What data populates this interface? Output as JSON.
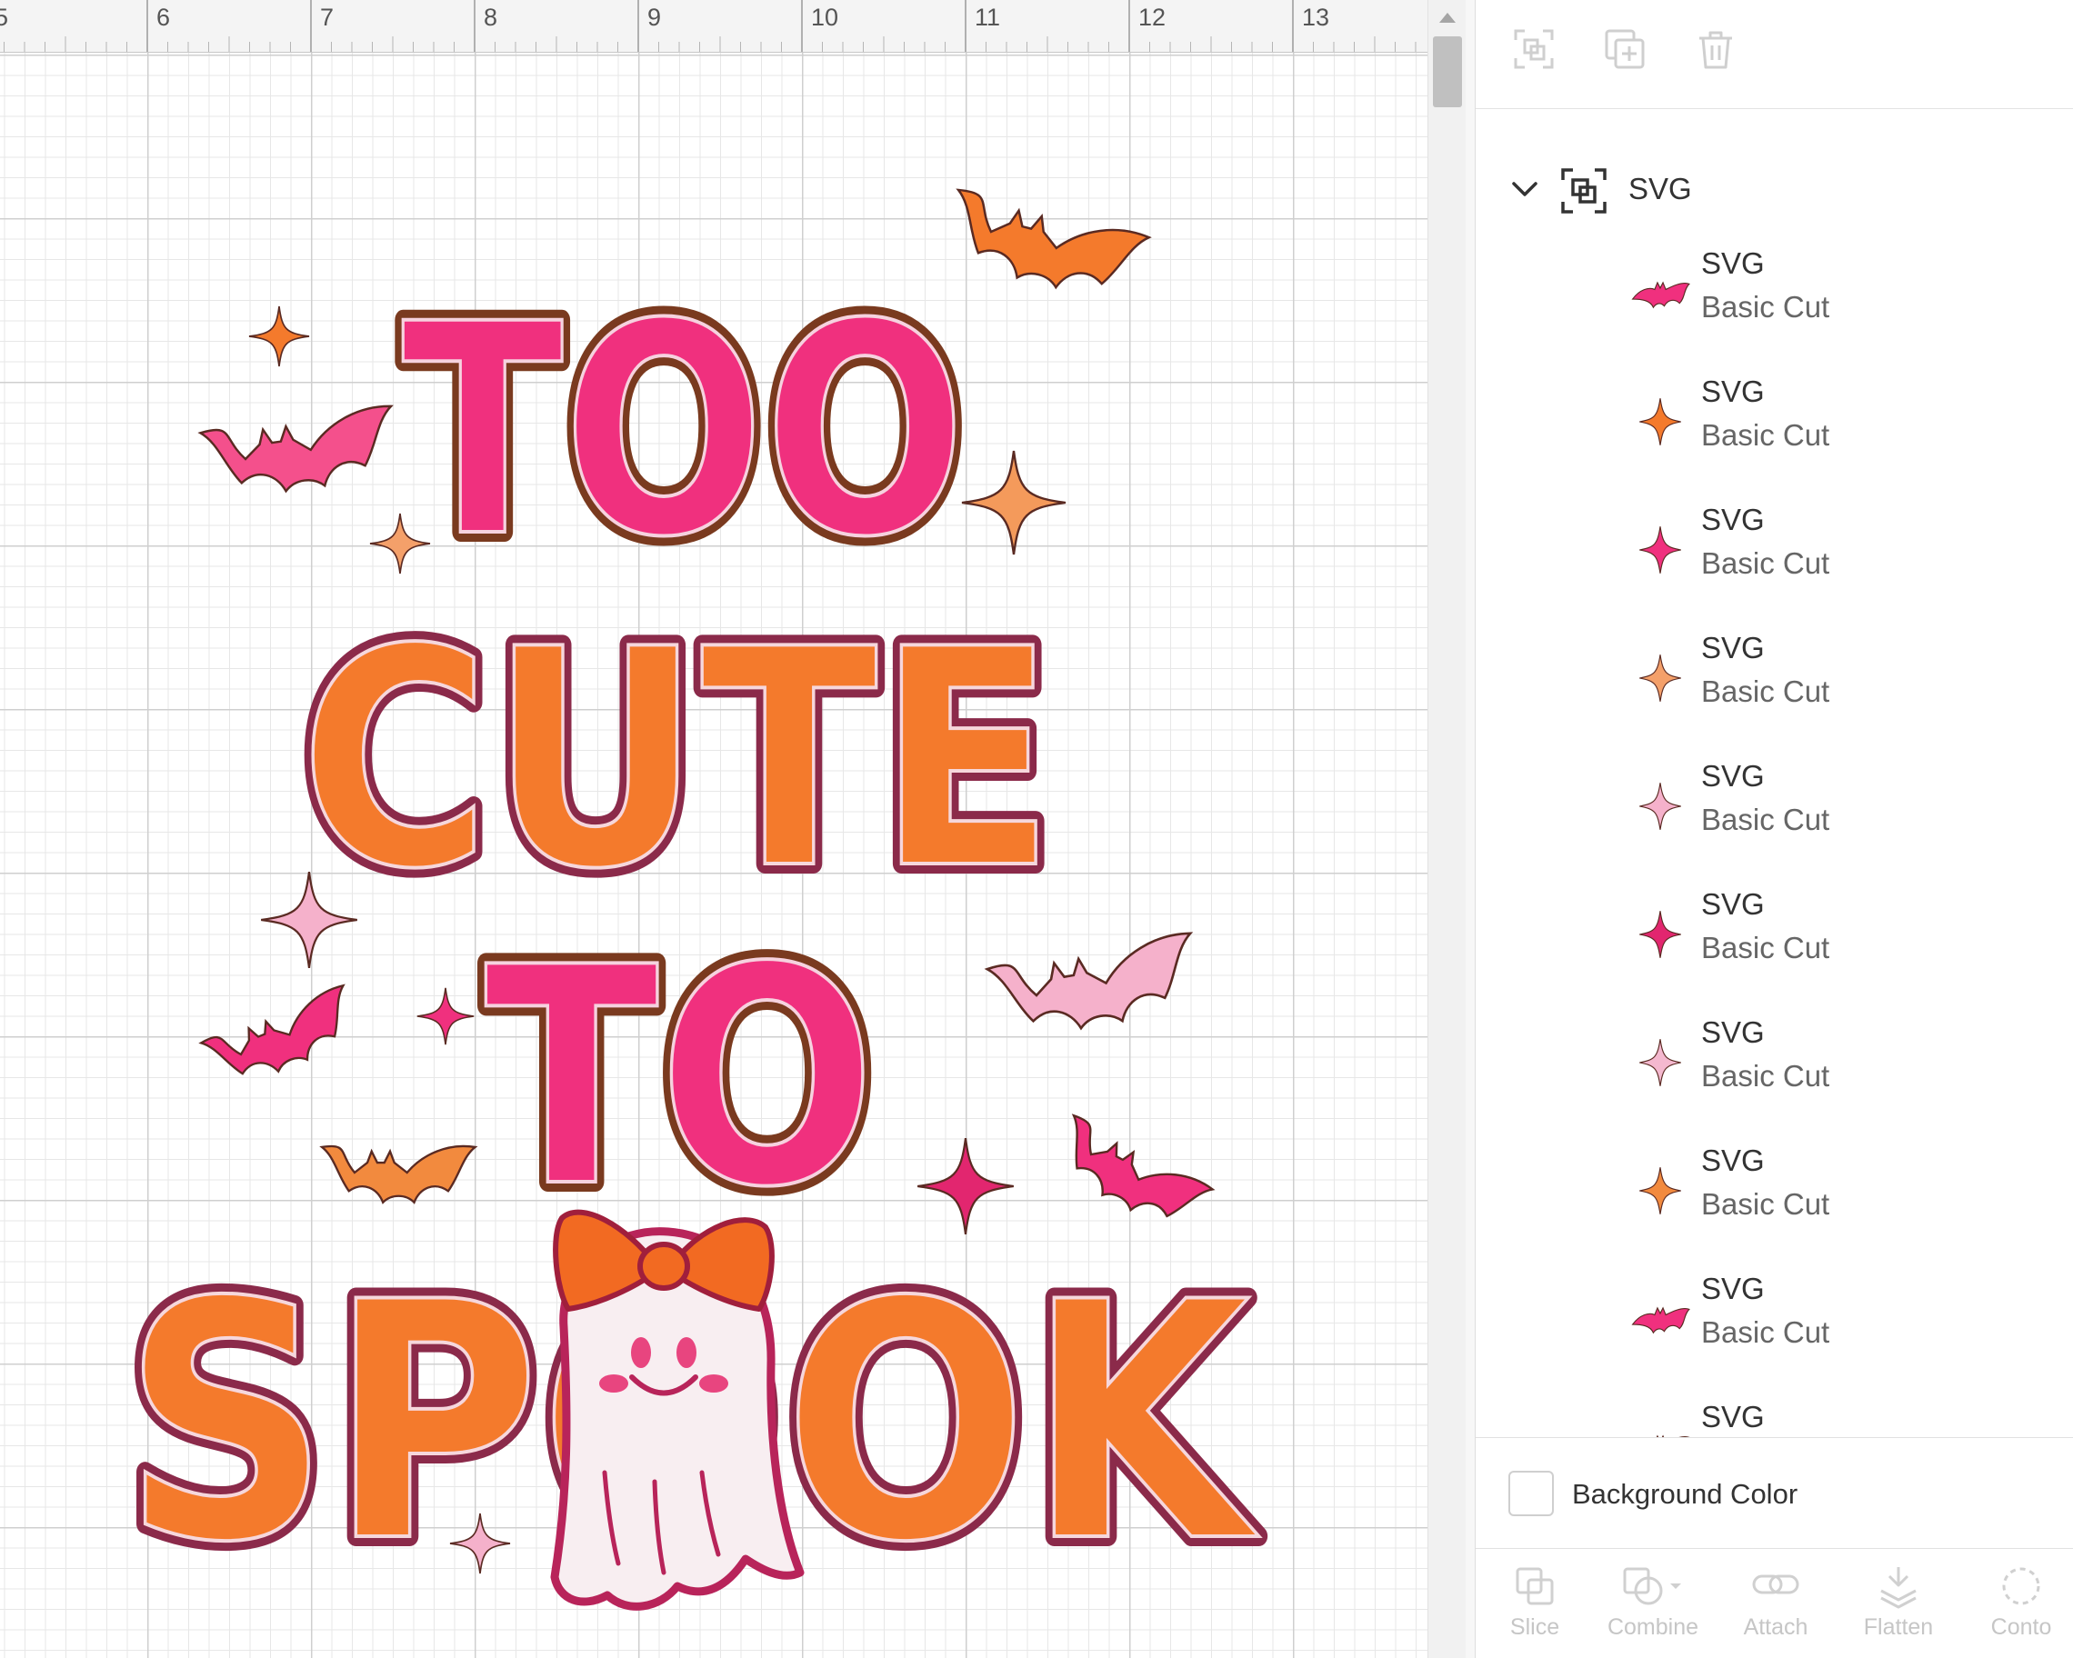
{
  "ruler": {
    "labels": [
      "5",
      "6",
      "7",
      "8",
      "9",
      "10",
      "11",
      "12",
      "13"
    ]
  },
  "artwork": {
    "lines": [
      "TOO",
      "CUTE",
      "TO",
      "SPOOK"
    ],
    "colors": {
      "pink": "#f0307e",
      "orange": "#f47a2c",
      "light_orange": "#f49a5b",
      "light_pink": "#f5b1cb",
      "outline": "#8b2a4a",
      "ghost": "#f8eef1"
    }
  },
  "panel": {
    "toolbar_icons": [
      "group-icon",
      "duplicate-icon",
      "delete-icon"
    ],
    "group": {
      "label": "SVG",
      "expanded": true
    },
    "layers": [
      {
        "name": "SVG",
        "operation": "Basic Cut",
        "thumb": "bat",
        "color": "#f0307e"
      },
      {
        "name": "SVG",
        "operation": "Basic Cut",
        "thumb": "sparkle",
        "color": "#f47a2c"
      },
      {
        "name": "SVG",
        "operation": "Basic Cut",
        "thumb": "sparkle",
        "color": "#f0307e"
      },
      {
        "name": "SVG",
        "operation": "Basic Cut",
        "thumb": "sparkle",
        "color": "#f4a06a"
      },
      {
        "name": "SVG",
        "operation": "Basic Cut",
        "thumb": "sparkle",
        "color": "#f5b1cb"
      },
      {
        "name": "SVG",
        "operation": "Basic Cut",
        "thumb": "sparkle",
        "color": "#e2266f"
      },
      {
        "name": "SVG",
        "operation": "Basic Cut",
        "thumb": "sparkle",
        "color": "#f4b8cf"
      },
      {
        "name": "SVG",
        "operation": "Basic Cut",
        "thumb": "sparkle",
        "color": "#f28a3e"
      },
      {
        "name": "SVG",
        "operation": "Basic Cut",
        "thumb": "bat",
        "color": "#f0307e"
      },
      {
        "name": "SVG",
        "operation": "",
        "thumb": "bat",
        "color": "#f47a2c"
      }
    ],
    "background_color": {
      "label": "Background Color"
    },
    "actions": [
      {
        "label": "Slice",
        "icon": "slice-icon"
      },
      {
        "label": "Combine",
        "icon": "combine-icon"
      },
      {
        "label": "Attach",
        "icon": "attach-icon"
      },
      {
        "label": "Flatten",
        "icon": "flatten-icon"
      },
      {
        "label": "Conto",
        "icon": "contour-icon"
      }
    ]
  }
}
